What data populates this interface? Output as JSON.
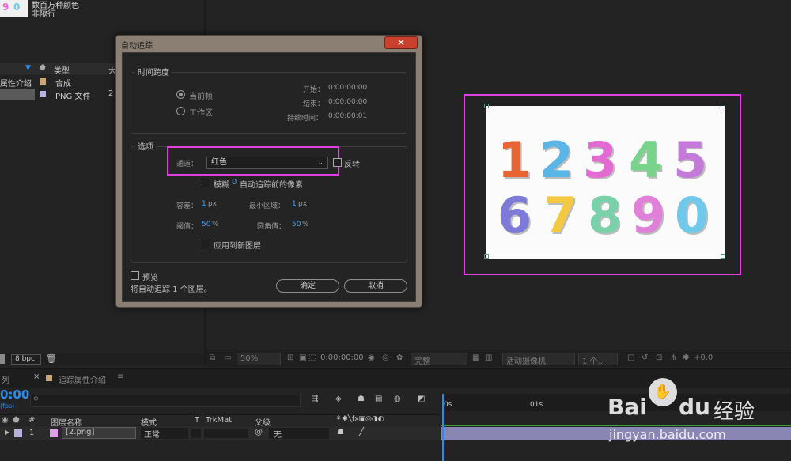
{
  "project": {
    "info_line1": "数百万种颜色",
    "info_line2": "非隔行",
    "column_type": "类型",
    "column_extra": "大",
    "rows": [
      {
        "name": "属性介绍",
        "type": "合成",
        "swatch": "#c8a878"
      },
      {
        "name": "",
        "type": "PNG 文件",
        "extra": "2",
        "swatch": "#b6b2dc"
      }
    ],
    "bit_depth": "8 bpc"
  },
  "viewer_toolbar": {
    "zoom": "50%",
    "timecode": "0:00:00:00",
    "quality": "完整",
    "camera": "活动摄像机",
    "views": "1 个...",
    "exposure": "+0.0"
  },
  "canvas": {
    "digits": [
      {
        "d": "1",
        "color": "#e86432"
      },
      {
        "d": "2",
        "color": "#5ab6e6"
      },
      {
        "d": "3",
        "color": "#e26ad2"
      },
      {
        "d": "4",
        "color": "#78d48a"
      },
      {
        "d": "5",
        "color": "#c37ad9"
      },
      {
        "d": "6",
        "color": "#7d7ad8"
      },
      {
        "d": "7",
        "color": "#f2c940"
      },
      {
        "d": "8",
        "color": "#7ad0a8"
      },
      {
        "d": "9",
        "color": "#e080d8"
      },
      {
        "d": "0",
        "color": "#70c8ea"
      }
    ]
  },
  "dialog": {
    "title": "自动追踪",
    "close": "✕",
    "time_span": {
      "title": "时间跨度",
      "option_current": "当前帧",
      "option_work_area": "工作区",
      "start_label": "开始：",
      "start_value": "0:00:00:00",
      "end_label": "结束：",
      "end_value": "0:00:00:00",
      "duration_label": "持续时间：",
      "duration_value": "0:00:00:01"
    },
    "options": {
      "title": "选项",
      "channel_label": "通道：",
      "channel_value": "红色",
      "invert_label": "反转",
      "blur_label": "模糊",
      "blur_value": "0",
      "blur_suffix": "自动追踪前的像素",
      "tolerance_label": "容差：",
      "tolerance_value": "1",
      "tolerance_unit": "px",
      "min_area_label": "最小区域：",
      "min_area_value": "1",
      "min_area_unit": "px",
      "threshold_label": "阈值：",
      "threshold_value": "50",
      "threshold_unit": "%",
      "corner_label": "圆角值：",
      "corner_value": "50",
      "corner_unit": "%",
      "new_layer_label": "应用到新图层"
    },
    "preview_label": "预览",
    "status": "将自动追踪 1 个图层。",
    "ok": "确定",
    "cancel": "取消"
  },
  "timeline": {
    "tab_left": "列",
    "tab_label": "追踪属性介绍",
    "timecode": "0:00",
    "fps": "(fps)",
    "col_num": "#",
    "col_name": "图层名称",
    "col_mode": "模式",
    "col_t": "T",
    "col_trkmat": "TrkMat",
    "col_parent": "父级",
    "layer_num": "1",
    "layer_name": "[2.png]",
    "layer_mode": "正常",
    "layer_parent": "无",
    "ruler_0": "0s",
    "ruler_1": "01s"
  },
  "watermark": {
    "brand": "Bai",
    "brand2": "du",
    "cn": "经验",
    "url": "jingyan.baidu.com"
  }
}
